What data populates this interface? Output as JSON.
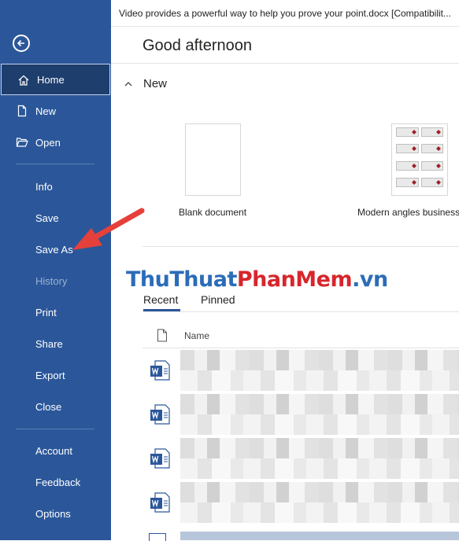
{
  "titlebar": {
    "text": "Video provides a powerful way to help you prove your point.docx [Compatibilit..."
  },
  "greeting": "Good afternoon",
  "sidebar": {
    "items": [
      {
        "label": "Home",
        "icon": "home-icon"
      },
      {
        "label": "New",
        "icon": "new-document-icon"
      },
      {
        "label": "Open",
        "icon": "open-folder-icon"
      },
      {
        "label": "Info"
      },
      {
        "label": "Save"
      },
      {
        "label": "Save As"
      },
      {
        "label": "History"
      },
      {
        "label": "Print"
      },
      {
        "label": "Share"
      },
      {
        "label": "Export"
      },
      {
        "label": "Close"
      },
      {
        "label": "Account"
      },
      {
        "label": "Feedback"
      },
      {
        "label": "Options"
      }
    ]
  },
  "new_section": {
    "heading": "New",
    "templates": [
      {
        "label": "Blank document"
      },
      {
        "label": "Modern angles business"
      }
    ]
  },
  "watermark": {
    "part1": "ThuThuat",
    "part2": "PhanMem",
    "part3": ".vn"
  },
  "recent": {
    "tabs": [
      {
        "label": "Recent"
      },
      {
        "label": "Pinned"
      }
    ],
    "column_name": "Name"
  },
  "colors": {
    "sidebar": "#2b579a",
    "active": "#1e3e6d",
    "arrow": "#e5403a"
  }
}
